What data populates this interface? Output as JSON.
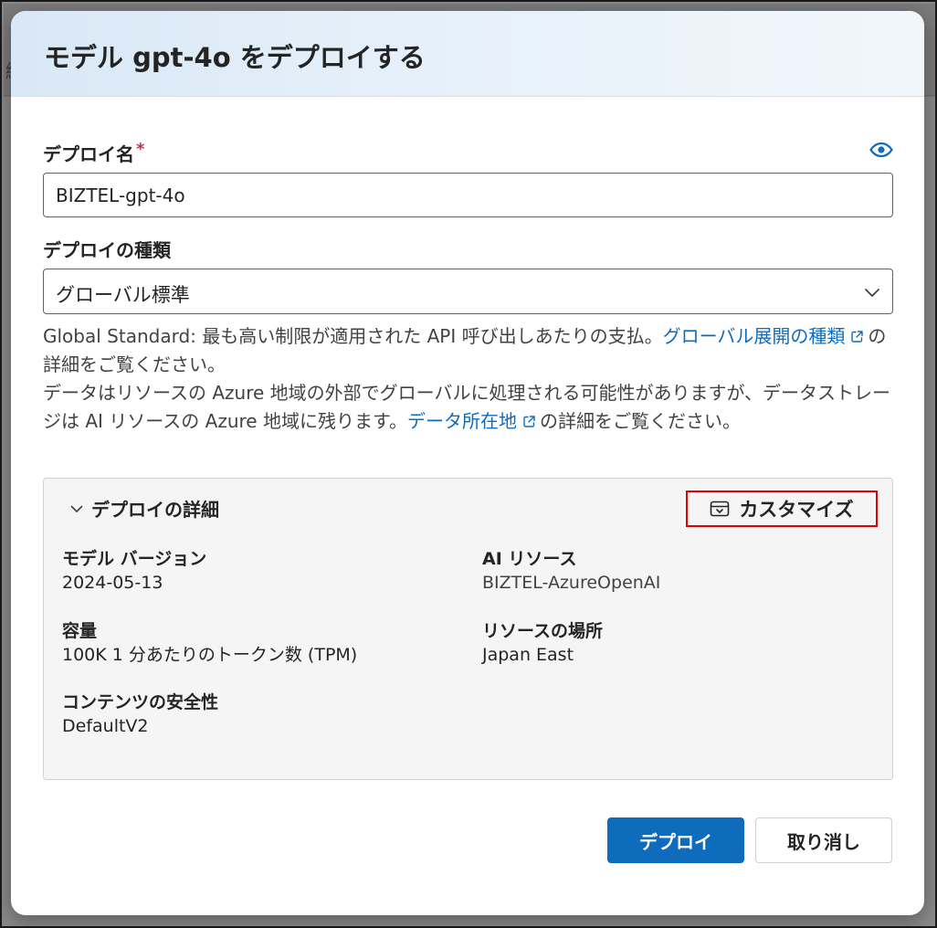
{
  "background": {
    "partial_glyph": "細"
  },
  "dialog": {
    "title": "モデル gpt-4o をデプロイする",
    "deployment_name": {
      "label": "デプロイ名",
      "required_mark": "*",
      "value": "BIZTEL-gpt-4o",
      "icon": "eye-icon"
    },
    "deployment_type": {
      "label": "デプロイの種類",
      "selected": "グローバル標準",
      "icon": "chevron-down-icon"
    },
    "description": {
      "line1_text": "Global Standard: 最も高い制限が適用された API 呼び出しあたりの支払。",
      "line1_link": "グローバル展開の種類",
      "line1_suffix": "の詳細をご覧ください。",
      "line2_text": "データはリソースの Azure 地域の外部でグローバルに処理される可能性がありますが、データストレージは AI リソースの Azure 地域に残ります。",
      "line2_link": "データ所在地",
      "line2_suffix": "の詳細をご覧ください。"
    },
    "details": {
      "title": "デプロイの詳細",
      "customize_label": "カスタマイズ",
      "properties": {
        "model_version": {
          "label": "モデル バージョン",
          "value": "2024-05-13"
        },
        "ai_resource": {
          "label": "AI リソース",
          "value": "BIZTEL-AzureOpenAI"
        },
        "capacity": {
          "label": "容量",
          "value": "100K 1 分あたりのトークン数 (TPM)"
        },
        "resource_location": {
          "label": "リソースの場所",
          "value": "Japan East"
        },
        "content_safety": {
          "label": "コンテンツの安全性",
          "value": "DefaultV2"
        }
      }
    },
    "buttons": {
      "deploy": "デプロイ",
      "cancel": "取り消し"
    }
  },
  "colors": {
    "accent": "#0f6cbd",
    "required": "#c4314b",
    "highlight_border": "#e00000",
    "header_bg": "#e3eef8",
    "panel_bg": "#f5f5f5"
  }
}
